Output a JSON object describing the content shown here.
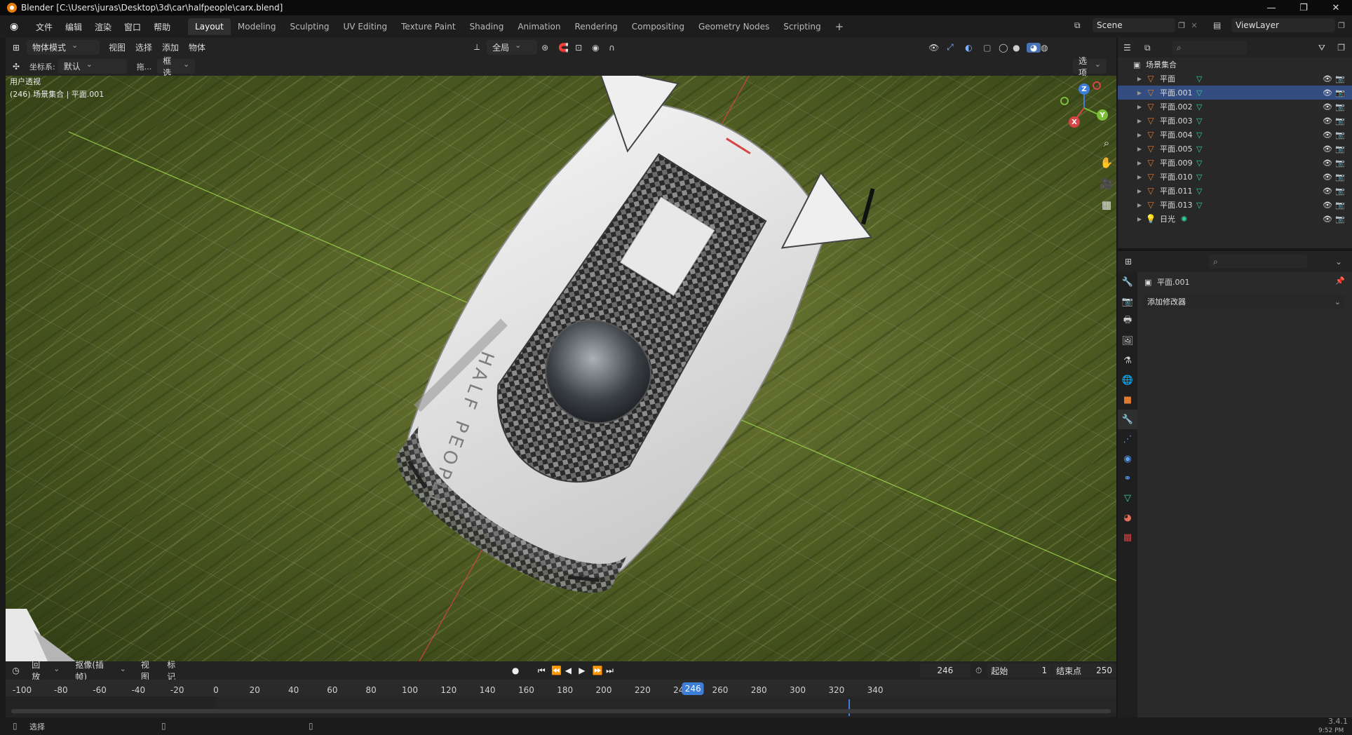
{
  "window": {
    "title": "Blender [C:\\Users\\juras\\Desktop\\3d\\car\\halfpeople\\carx.blend]",
    "minimize": "—",
    "restore": "❐",
    "close": "✕"
  },
  "menu": [
    "文件",
    "编辑",
    "渲染",
    "窗口",
    "帮助"
  ],
  "workspaces": [
    "Layout",
    "Modeling",
    "Sculpting",
    "UV Editing",
    "Texture Paint",
    "Shading",
    "Animation",
    "Rendering",
    "Compositing",
    "Geometry Nodes",
    "Scripting"
  ],
  "workspace_add": "+",
  "scene": {
    "name": "Scene",
    "view_layer": "ViewLayer"
  },
  "viewport_header": {
    "mode": "物体模式",
    "menus": [
      "视图",
      "选择",
      "添加",
      "物体"
    ],
    "transform_orientation": "全局",
    "coord_label": "坐标系:",
    "coord_value": "默认",
    "drag_label": "拖...",
    "drag_value": "框选",
    "options": "选项"
  },
  "viewport": {
    "info_line1": "用户透视",
    "info_line2": "(246) 场景集合 | 平面.001",
    "car_text": "HALF PEOPLE"
  },
  "gizmo": {
    "x": "X",
    "y": "Y",
    "z": "Z"
  },
  "outliner": {
    "collection": "场景集合",
    "items": [
      "平面",
      "平面.001",
      "平面.002",
      "平面.003",
      "平面.004",
      "平面.005",
      "平面.009",
      "平面.010",
      "平面.011",
      "平面.013",
      "日光"
    ]
  },
  "properties": {
    "object_name": "平面.001",
    "add_modifier": "添加修改器"
  },
  "timeline": {
    "menus": [
      "回放",
      "抠像(插帧)",
      "视图",
      "标记"
    ],
    "current_frame": "246",
    "start_label": "起始",
    "start_value": "1",
    "end_label": "结束点",
    "end_value": "250",
    "ticks": [
      "-100",
      "-80",
      "-60",
      "-40",
      "-20",
      "0",
      "20",
      "40",
      "60",
      "80",
      "100",
      "120",
      "140",
      "160",
      "180",
      "200",
      "220",
      "240",
      "246",
      "260",
      "280",
      "300",
      "320",
      "340"
    ]
  },
  "statusbar": {
    "select": "选择",
    "version": "3.4.1",
    "clock": "9:52 PM"
  },
  "colors": {
    "accent": "#4772b3",
    "object_orange": "#e07a30",
    "mesh_green": "#35d49a",
    "frame_blue": "#3d7fd8"
  }
}
